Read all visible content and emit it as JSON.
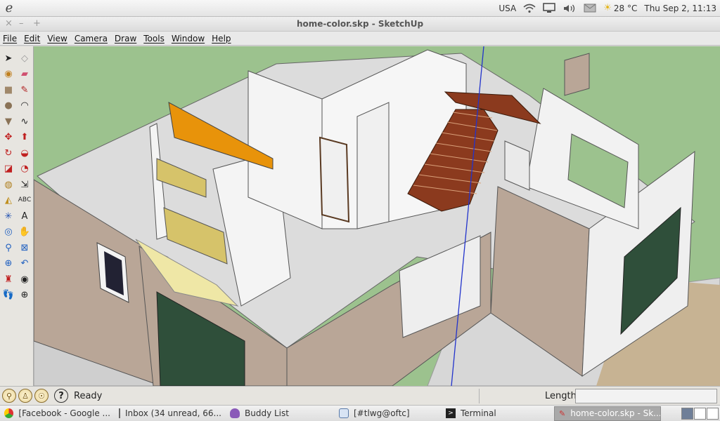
{
  "system_panel": {
    "keyboard_layout": "USA",
    "weather_temp": "28 °C",
    "clock": "Thu Sep  2, 11:13"
  },
  "window": {
    "title": "home-color.skp - SketchUp",
    "controls": [
      "×",
      "–",
      "+"
    ]
  },
  "menu": [
    "File",
    "Edit",
    "View",
    "Camera",
    "Draw",
    "Tools",
    "Window",
    "Help"
  ],
  "toolbar_tools": [
    [
      "select-icon",
      "eraser-icon"
    ],
    [
      "paint-bucket-icon",
      "erase-icon"
    ],
    [
      "rectangle-icon",
      "line-icon"
    ],
    [
      "circle-icon",
      "arc-icon"
    ],
    [
      "polygon-icon",
      "freehand-icon"
    ],
    [
      "move-icon",
      "push-pull-icon"
    ],
    [
      "rotate-icon",
      "follow-me-icon"
    ],
    [
      "scale-icon",
      "offset-icon"
    ],
    [
      "tape-measure-icon",
      "dimension-icon"
    ],
    [
      "protractor-icon",
      "text-icon"
    ],
    [
      "axes-icon",
      "3d-text-icon"
    ],
    [
      "orbit-icon",
      "pan-icon"
    ],
    [
      "zoom-icon",
      "zoom-window-icon"
    ],
    [
      "zoom-extents-icon",
      "previous-view-icon"
    ],
    [
      "position-camera-icon",
      "look-around-icon"
    ],
    [
      "walk-icon",
      "section-plane-icon"
    ]
  ],
  "status_bar": {
    "status_text": "Ready",
    "help_symbol": "?",
    "measurement_label": "Length",
    "measurement_value": ""
  },
  "taskbar": [
    {
      "label": "[Facebook - Google ...",
      "icon": "chrome-icon",
      "active": false
    },
    {
      "label": "Inbox (34 unread, 66...",
      "icon": "mail-icon",
      "active": false
    },
    {
      "label": "Buddy List",
      "icon": "pidgin-icon",
      "active": false
    },
    {
      "label": "[#tlwg@oftc]",
      "icon": "chat-icon",
      "active": false
    },
    {
      "label": "Terminal",
      "icon": "terminal-icon",
      "active": false
    },
    {
      "label": "home-color.skp - Sk...",
      "icon": "sketchup-icon",
      "active": true
    }
  ],
  "colors": {
    "ground": "#9cc28e",
    "wall_exterior": "#b9a697",
    "wall_interior": "#f2f2f2",
    "floor": "#dcdcdc",
    "stair_wood": "#8b3a1e",
    "accent_wall": "#e8930a",
    "kitchen_floor": "#efe7a6",
    "patio": "#c7b393"
  }
}
